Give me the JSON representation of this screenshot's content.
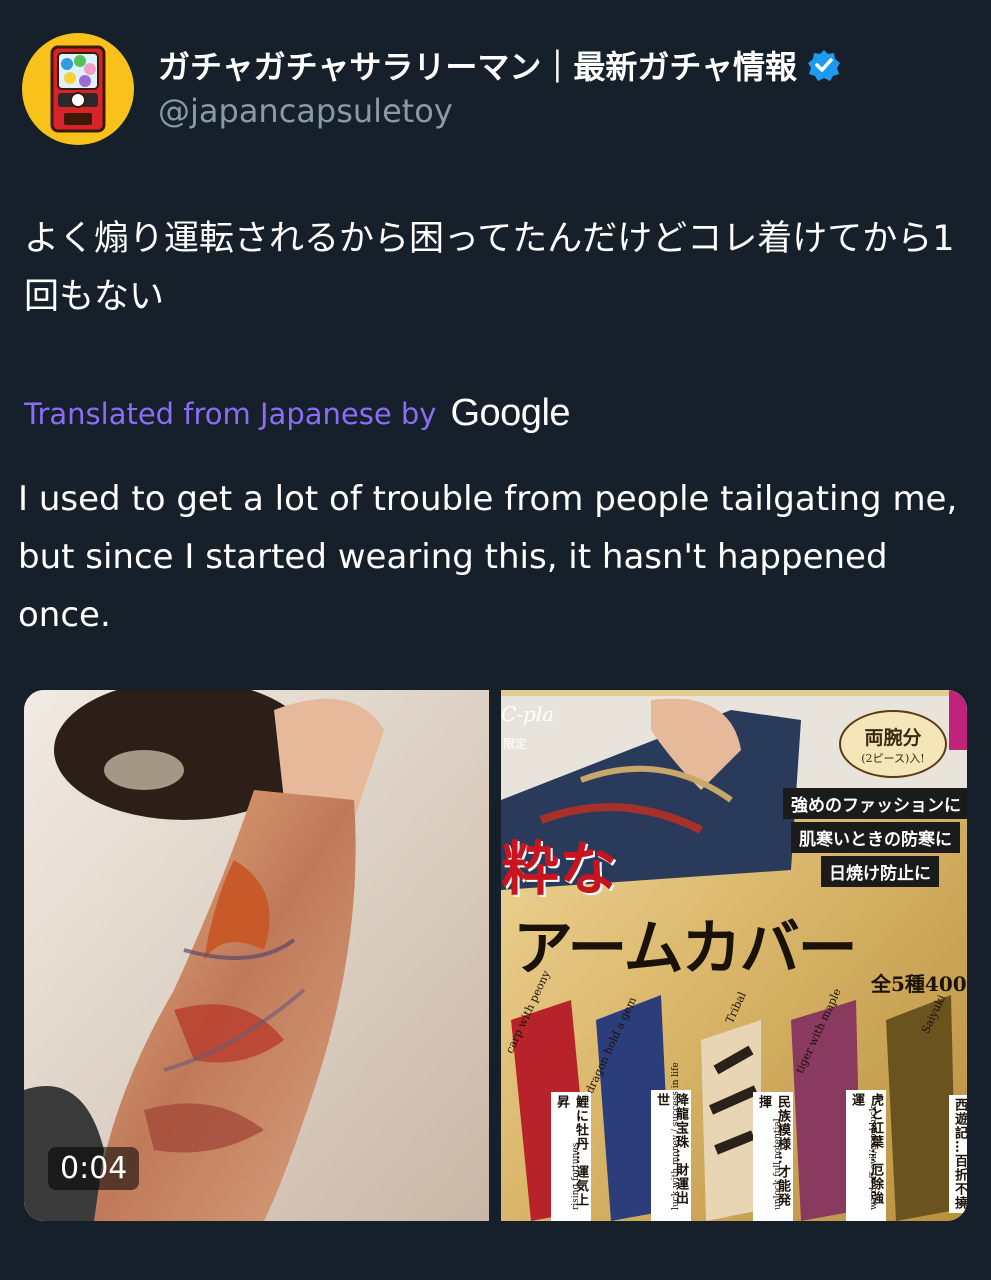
{
  "header": {
    "display_name": "ガチャガチャサラリーマン｜最新ガチャ情報",
    "handle": "@japancapsuletoy",
    "avatar_icon": "gachapon-machine-icon",
    "verified_icon": "verified-badge-icon",
    "verified_color": "#1d9bf0"
  },
  "tweet": {
    "text_ja": "よく煽り運転されるから困ってたんだけどコレ着けてから1回もない",
    "translated_label": "Translated from Japanese by",
    "translator_logo_text": "Google",
    "text_en": "I used to get a lot of trouble from people tailgating me, but since I started wearing this, it hasn't happened once."
  },
  "media": {
    "video_duration": "0:04",
    "ad": {
      "brand": "C-pla",
      "limited": "限定",
      "badge_title": "両腕分",
      "badge_sub": "(2ピース)入!",
      "tags": [
        "強めのファッションに",
        "肌寒いときの防寒に",
        "日焼け防止に"
      ],
      "headline_red": "粋な",
      "headline": "アームカバー",
      "count": "全5種400",
      "sleeves": [
        {
          "en": "carp with peony",
          "jp": "鯉に牡丹…運気上昇",
          "en_sub": "rising fortunes",
          "color": "#b8232b"
        },
        {
          "en": "dragon hold a gem",
          "jp": "降龍宝珠…財運出世",
          "en_sub": "luck with money / success in life",
          "color": "#2b3d7a"
        },
        {
          "en": "Tribal",
          "jp": "民族模様…才能発揮",
          "en_sub": "unlock full potential",
          "color": "#2a2118"
        },
        {
          "en": "tiger with maple",
          "jp": "虎と紅葉…厄除強運",
          "en_sub": "ward off evil/good luck",
          "color": "#8a3a5e"
        },
        {
          "en": "Saiyuki",
          "jp": "西遊記…百折不撓",
          "en_sub": "",
          "color": "#6b5320"
        }
      ]
    }
  }
}
